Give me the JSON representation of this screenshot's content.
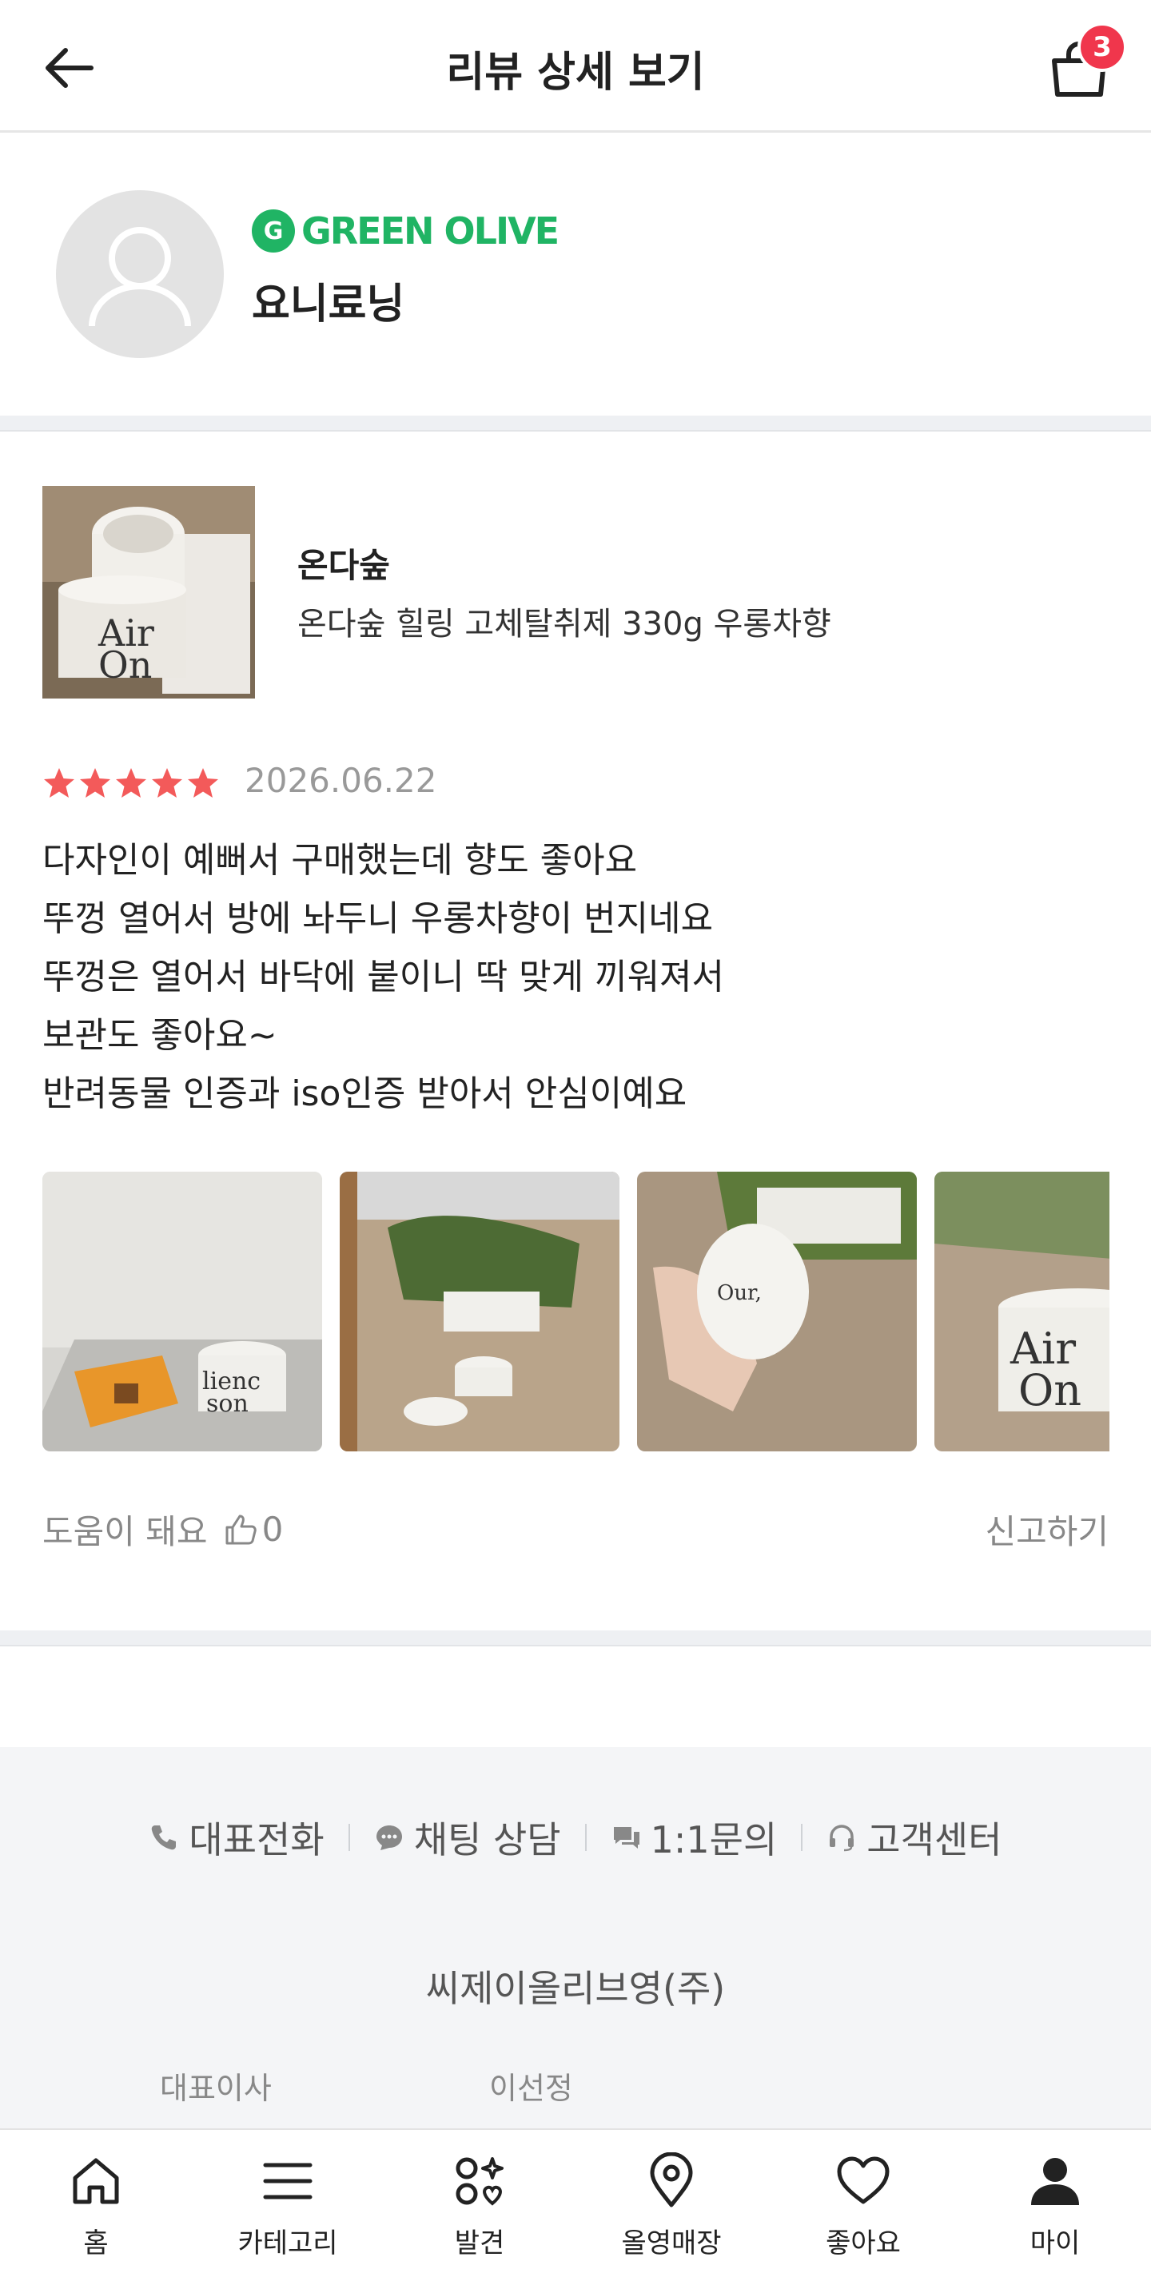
{
  "header": {
    "title": "리뷰 상세 보기",
    "cart_count": "3"
  },
  "profile": {
    "grade_letter": "G",
    "grade": "GREEN OLIVE",
    "nickname": "요니료닝",
    "grade_color": "#20b464"
  },
  "product": {
    "brand": "온다숲",
    "name": "온다숲 힐링 고체탈취제 330g 우롱차향"
  },
  "review": {
    "rating": 5,
    "rating_max": 5,
    "star_color": "#f35a5a",
    "date": "2026.06.22",
    "lines": [
      "다자인이 예뻐서 구매했는데 향도 좋아요",
      "뚜껑 열어서 방에 놔두니 우롱차향이 번지네요",
      "뚜껑은 열어서 바닥에 붙이니 딱 맞게 끼워져서",
      "보관도 좋아요~",
      "반려동물 인증과 iso인증 받아서 안심이예요"
    ],
    "photo_count": 4,
    "helpful_label": "도움이 돼요",
    "helpful_count": "0",
    "report_label": "신고하기"
  },
  "footer": {
    "links": [
      {
        "label": "대표전화",
        "icon": "phone-icon"
      },
      {
        "label": "채팅 상담",
        "icon": "chat-bubble-icon"
      },
      {
        "label": "1:1문의",
        "icon": "inquiry-icon"
      },
      {
        "label": "고객센터",
        "icon": "headset-icon"
      }
    ],
    "company": "씨제이올리브영(주)",
    "ceo_label": "대표이사",
    "ceo_name": "이선정"
  },
  "nav": {
    "items": [
      {
        "label": "홈",
        "icon": "home-icon"
      },
      {
        "label": "카테고리",
        "icon": "menu-icon"
      },
      {
        "label": "발견",
        "icon": "discover-icon"
      },
      {
        "label": "올영매장",
        "icon": "location-pin-icon"
      },
      {
        "label": "좋아요",
        "icon": "heart-icon"
      },
      {
        "label": "마이",
        "icon": "person-icon"
      }
    ]
  }
}
